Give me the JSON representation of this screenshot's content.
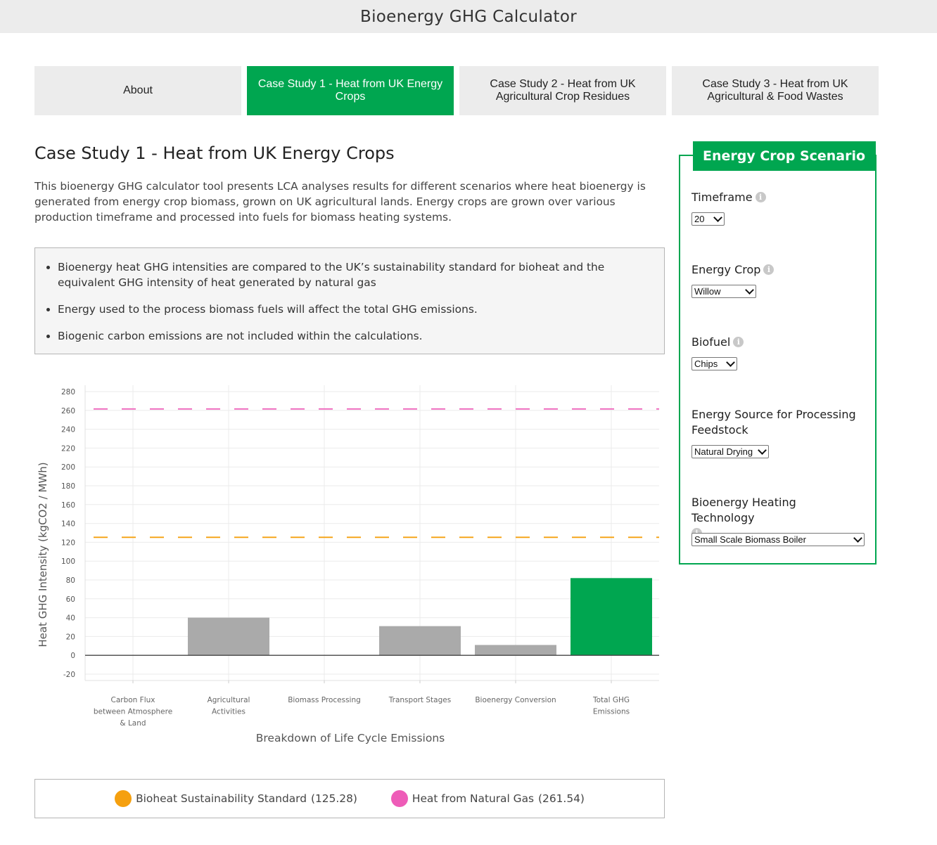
{
  "app": {
    "title": "Bioenergy GHG Calculator"
  },
  "tabs": [
    {
      "label": "About",
      "active": false
    },
    {
      "label": "Case Study 1 - Heat from UK Energy Crops",
      "active": true
    },
    {
      "label": "Case Study 2 - Heat from UK Agricultural Crop Residues",
      "active": false
    },
    {
      "label": "Case Study 3 - Heat from UK Agricultural & Food Wastes",
      "active": false
    }
  ],
  "main": {
    "heading": "Case Study 1 - Heat from UK Energy Crops",
    "intro": "This bioenergy GHG calculator tool presents LCA analyses results for different scenarios where heat bioenergy is generated from energy crop biomass, grown on UK agricultural lands. Energy crops are grown over various production timeframe and processed into fuels for biomass heating systems.",
    "notes": [
      "Bioenergy heat GHG intensities are compared to the UK’s sustainability standard for bioheat and the equivalent GHG intensity of heat generated by natural gas",
      "Energy used to the process biomass fuels will affect the total GHG emissions.",
      "Biogenic carbon emissions are not included within the calculations."
    ]
  },
  "chart_data": {
    "type": "bar",
    "categories": [
      "Carbon Flux between Atmosphere & Land",
      "Agricultural Activities",
      "Biomass Processing",
      "Transport Stages",
      "Bioenergy Conversion",
      "Total GHG Emissions"
    ],
    "category_lines": [
      [
        "Carbon Flux",
        "between Atmosphere",
        "& Land"
      ],
      [
        "Agricultural",
        "Activities"
      ],
      [
        "Biomass Processing"
      ],
      [
        "Transport Stages"
      ],
      [
        "Bioenergy Conversion"
      ],
      [
        "Total GHG",
        "Emissions"
      ]
    ],
    "values": [
      0,
      40,
      0,
      31,
      11,
      82
    ],
    "bar_colors": [
      "#aaaaaa",
      "#aaaaaa",
      "#aaaaaa",
      "#aaaaaa",
      "#aaaaaa",
      "#00a650"
    ],
    "xlabel": "Breakdown of Life Cycle Emissions",
    "ylabel": "Heat GHG Intensity (kgCO2 / MWh)",
    "ylim": [
      -20,
      280
    ],
    "yticks": [
      -20,
      0,
      20,
      40,
      60,
      80,
      100,
      120,
      140,
      160,
      180,
      200,
      220,
      240,
      260,
      280
    ],
    "grid": true,
    "reference_lines": [
      {
        "name": "Bioheat Sustainability Standard",
        "value": 125.28,
        "color": "#f5a00f"
      },
      {
        "name": "Heat from Natural Gas",
        "value": 261.54,
        "color": "#ee5cb8"
      }
    ]
  },
  "legend": {
    "items": [
      {
        "name": "Bioheat Sustainability Standard",
        "value_text": "(125.28)",
        "color": "#f5a00f"
      },
      {
        "name": "Heat from Natural Gas",
        "value_text": "(261.54)",
        "color": "#ee5cb8"
      }
    ]
  },
  "scenario": {
    "title": "Energy Crop Scenario",
    "timeframe": {
      "label": "Timeframe",
      "value": "20"
    },
    "energy_crop": {
      "label": "Energy Crop",
      "value": "Willow"
    },
    "biofuel": {
      "label": "Biofuel",
      "value": "Chips"
    },
    "energy_source": {
      "label": "Energy Source for Processing Feedstock",
      "value": "Natural Drying"
    },
    "heating_tech": {
      "label": "Bioenergy Heating Technology",
      "value": "Small Scale Biomass Boiler"
    }
  },
  "colors": {
    "accent": "#00a650",
    "standard": "#f5a00f",
    "gas": "#ee5cb8",
    "bar": "#aaaaaa"
  },
  "icons": {
    "info": "info-icon",
    "dropdown": "chevron-down-icon"
  }
}
